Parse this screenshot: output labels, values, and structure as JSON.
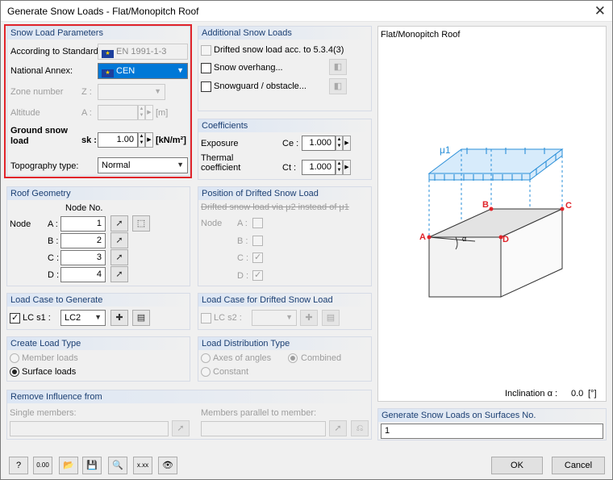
{
  "window": {
    "title": "Generate Snow Loads  -  Flat/Monopitch Roof",
    "close_glyph": "✕"
  },
  "snow_params": {
    "title": "Snow Load Parameters",
    "standard_label": "According to Standard:",
    "standard_value": "EN 1991-1-3",
    "annex_label": "National Annex:",
    "annex_value": "CEN",
    "zone_label": "Zone number",
    "zone_symbol": "Z :",
    "altitude_label": "Altitude",
    "altitude_symbol": "A :",
    "altitude_unit": "[m]",
    "ground_label_1": "Ground snow",
    "ground_label_2": "load",
    "sk_symbol": "sk :",
    "sk_value": "1.00",
    "sk_unit": "[kN/m²]",
    "topo_label": "Topography type:",
    "topo_value": "Normal"
  },
  "additional": {
    "title": "Additional Snow Loads",
    "drifted": "Drifted snow load acc. to 5.3.4(3)",
    "overhang": "Snow overhang...",
    "snowguard": "Snowguard / obstacle..."
  },
  "coefficients": {
    "title": "Coefficients",
    "exposure_label": "Exposure",
    "ce_symbol": "Ce :",
    "ce_value": "1.000",
    "thermal_label_1": "Thermal",
    "thermal_label_2": "coefficient",
    "ct_symbol": "Ct :",
    "ct_value": "1.000"
  },
  "roof_geometry": {
    "title": "Roof Geometry",
    "node_no_header": "Node No.",
    "node_label": "Node",
    "rows": [
      {
        "key": "A :",
        "value": "1"
      },
      {
        "key": "B :",
        "value": "2"
      },
      {
        "key": "C :",
        "value": "3"
      },
      {
        "key": "D :",
        "value": "4"
      }
    ]
  },
  "drift_position": {
    "title": "Position of Drifted Snow Load",
    "description": "Drifted snow load via μ2 instead of μ1",
    "node_label": "Node",
    "rows": [
      "A :",
      "B :",
      "C :",
      "D :"
    ]
  },
  "load_case": {
    "title": "Load Case to Generate",
    "lc_label": "LC s1 :",
    "lc_value": "LC2"
  },
  "load_case_drift": {
    "title": "Load Case for Drifted Snow Load",
    "lc_label": "LC s2 :"
  },
  "load_type": {
    "title": "Create Load Type",
    "member": "Member loads",
    "surface": "Surface loads"
  },
  "distribution": {
    "title": "Load Distribution Type",
    "axes": "Axes of angles",
    "combined": "Combined",
    "constant": "Constant"
  },
  "remove_influence": {
    "title": "Remove Influence from",
    "single": "Single members:",
    "parallel": "Members parallel to member:"
  },
  "preview": {
    "title": "Flat/Monopitch Roof",
    "mu": "μ1",
    "alpha": "α",
    "a": "A",
    "b": "B",
    "c": "C",
    "d": "D",
    "inclination_label": "Inclination  α :",
    "inclination_value": "0.0",
    "inclination_unit": "[°]"
  },
  "surfaces": {
    "title": "Generate Snow Loads on Surfaces No.",
    "value": "1"
  },
  "buttons": {
    "ok": "OK",
    "cancel": "Cancel"
  },
  "toolbar": [
    "help-icon",
    "units-icon",
    "open-icon",
    "save-icon",
    "view-icon",
    "decimals-icon",
    "eye-icon"
  ],
  "colors": {
    "group_header": "#1b3f73",
    "highlight": "#e0232a",
    "snow": "#2a8fd8",
    "point": "#e0232a"
  }
}
